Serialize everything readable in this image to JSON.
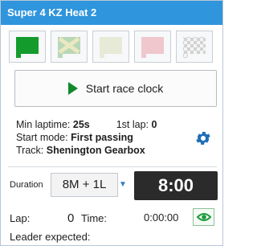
{
  "header": {
    "title": "Super 4 KZ Heat 2"
  },
  "flags": [
    {
      "name": "green",
      "state": "active"
    },
    {
      "name": "green-yellow-crossed",
      "state": "disabled"
    },
    {
      "name": "white",
      "state": "disabled"
    },
    {
      "name": "red",
      "state": "disabled"
    },
    {
      "name": "chequered",
      "state": "disabled"
    }
  ],
  "start_button": {
    "label": "Start race clock"
  },
  "info": {
    "min_laptime_label": "Min laptime:",
    "min_laptime_value": "25s",
    "first_lap_label": "1st lap:",
    "first_lap_value": "0",
    "start_mode_label": "Start mode:",
    "start_mode_value": "First passing",
    "track_label": "Track:",
    "track_value": "Shenington Gearbox"
  },
  "duration": {
    "label": "Duration",
    "value": "8M + 1L",
    "arrow": "▼"
  },
  "timer": {
    "value": "8:00"
  },
  "lap": {
    "label": "Lap:",
    "value": "0"
  },
  "time": {
    "label": "Time:",
    "value": "0:00:00"
  },
  "leader": {
    "label": "Leader expected:"
  },
  "colors": {
    "header_bg": "#2f95dc",
    "green_flag": "#139b2c",
    "timer_bg": "#2b2b2b",
    "gear": "#1f6fb8",
    "eye": "#1c9a3a"
  }
}
